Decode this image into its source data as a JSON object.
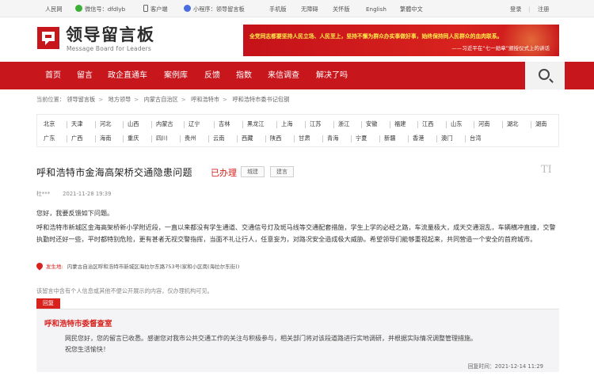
{
  "topbar": {
    "left_items": [
      {
        "label": "人民网",
        "icon": "people-icon"
      },
      {
        "label": "微信号：dfdlyb",
        "icon": "wechat-icon"
      },
      {
        "label": "客户端",
        "icon": "phone-icon"
      },
      {
        "label": "小程序：领导留言板",
        "icon": "miniprogram-icon"
      },
      {
        "label": "手机版",
        "icon": ""
      },
      {
        "label": "无障碍",
        "icon": ""
      },
      {
        "label": "关怀版",
        "icon": ""
      },
      {
        "label": "English",
        "icon": ""
      },
      {
        "label": "繁體中文",
        "icon": ""
      }
    ],
    "login": "登录",
    "separator": "|",
    "register": "注册"
  },
  "header": {
    "logo_cn": "领导留言板",
    "logo_en": "Message Board for Leaders",
    "banner_line1": "全党同志都要坚持人民立场、人民至上，坚持不懈为群众办实事做好事，始终保持同人民群众的血肉联系。",
    "banner_line2": "——习近平在“七一勋章”颁授仪式上的讲话",
    "brand_color": "#c8161d"
  },
  "nav": {
    "tabs": [
      "首页",
      "留言",
      "政企直通车",
      "案例库",
      "反馈",
      "指数",
      "来信调查",
      "解决了吗"
    ]
  },
  "breadcrumb": {
    "prefix": "当前位置：",
    "items": [
      "领导留言板",
      "地方领导",
      "内蒙古自治区",
      "呼和浩特市",
      "呼和浩特市委书记包钢"
    ]
  },
  "regions": {
    "row1": [
      "北京",
      "天津",
      "河北",
      "山西",
      "内蒙古",
      "辽宁",
      "吉林",
      "黑龙江",
      "上海",
      "江苏",
      "浙江",
      "安徽",
      "福建",
      "江西",
      "山东",
      "河南",
      "湖北",
      "湖南"
    ],
    "row2": [
      "广东",
      "广西",
      "海南",
      "重庆",
      "四川",
      "贵州",
      "云南",
      "西藏",
      "陕西",
      "甘肃",
      "青海",
      "宁夏",
      "新疆",
      "香港",
      "澳门",
      "台湾"
    ]
  },
  "article": {
    "title": "呼和浩特市金海高架桥交通隐患问题",
    "status": "已办理",
    "tags": [
      "城建",
      "建言"
    ],
    "font_toggle": "TI",
    "author": "杜***",
    "time": "2021-11-28 19:39",
    "greeting": "您好，我要反馈如下问题。",
    "content": "呼和浩特市新城区金海高架桥新小学附近段，一直以来都没有学生通道、交通信号灯及斑马线等交通配套措施，学生上学的必经之路，车流量极大，成天交通混乱，车辆横冲直撞，交警执勤时还好一些，平时都特别危险，更有甚者无视交警指挥，当面不礼让行人，任意妄为，对路况安全造成极大威胁。希望领导们能够重视起来，共同营造一个安全的首府城市。",
    "location_label": "发生地:",
    "location": "内蒙古自治区呼和浩特市新城区海拉尔东路753号(家和小区南(海拉尔东街))",
    "notice": "该留言中含有个人信息或其他不便公开展示的内容，仅办理机构可见。"
  },
  "reply": {
    "tag": "回复",
    "org": "呼和浩特市委督查室",
    "lines": [
      "网民您好，您的留言已收悉。感谢您对我市公共交通工作的关注与积极参与，相关部门将对该段道路进行实地调研，并根据实际情况调整管理措施。",
      "祝您生活愉快！"
    ],
    "time": "回复时间：2021-12-14 11:29"
  }
}
